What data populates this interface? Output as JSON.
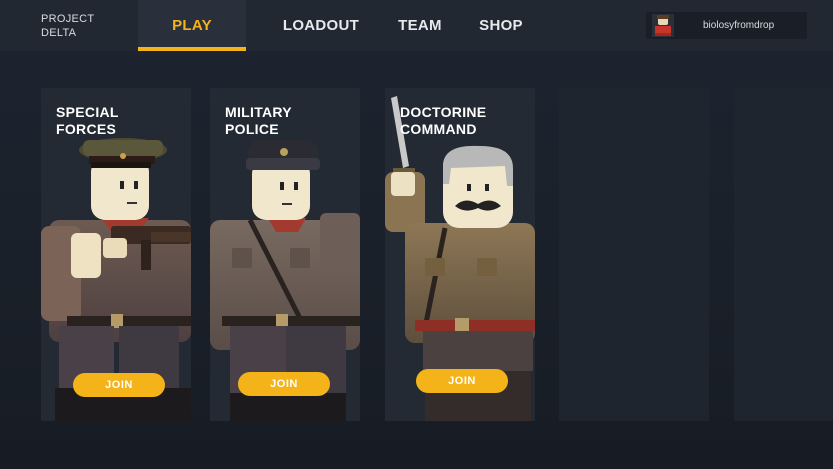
{
  "header": {
    "brand": "PROJECT\nDELTA",
    "tabs": [
      {
        "label": "PLAY",
        "active": true
      },
      {
        "label": "LOADOUT",
        "active": false
      },
      {
        "label": "TEAM",
        "active": false
      },
      {
        "label": "SHOP",
        "active": false
      }
    ],
    "user": {
      "name": "biolosyfromdrop"
    }
  },
  "cards": [
    {
      "title": "SPECIAL\nFORCES",
      "join_label": "JOIN"
    },
    {
      "title": "MILITARY\nPOLICE",
      "join_label": "JOIN"
    },
    {
      "title": "DOCTORINE\nCOMMAND",
      "join_label": "JOIN"
    }
  ],
  "colors": {
    "accent": "#f5b31a",
    "background": "#1e2430",
    "card": "#232a33"
  }
}
